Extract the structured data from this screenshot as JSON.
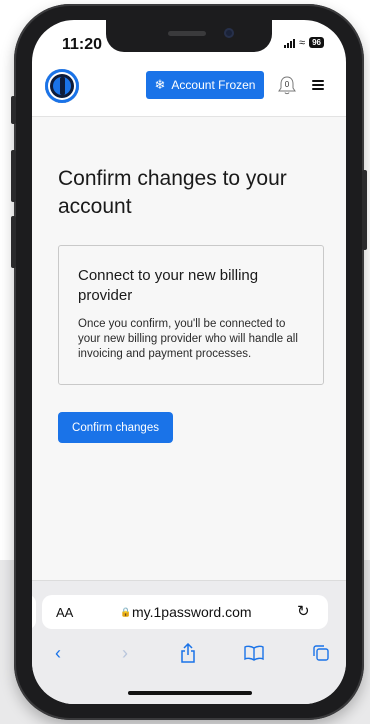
{
  "status_bar": {
    "time": "11:20",
    "battery": "96"
  },
  "header": {
    "account_frozen_label": "Account Frozen",
    "notifications_count": "0"
  },
  "main": {
    "title": "Confirm changes to your account",
    "card": {
      "title": "Connect to your new billing provider",
      "body": "Once you confirm, you'll be connected to your new billing provider who will handle all invoicing and payment processes."
    },
    "confirm_button_label": "Confirm changes"
  },
  "browser": {
    "text_size_label": "AA",
    "url": "my.1password.com",
    "icons": [
      "lock-icon",
      "reload-icon",
      "back-icon",
      "forward-icon",
      "share-icon",
      "bookmarks-icon",
      "tabs-icon"
    ]
  },
  "colors": {
    "accent": "#1a73e8",
    "frame": "#1c1c1e"
  }
}
